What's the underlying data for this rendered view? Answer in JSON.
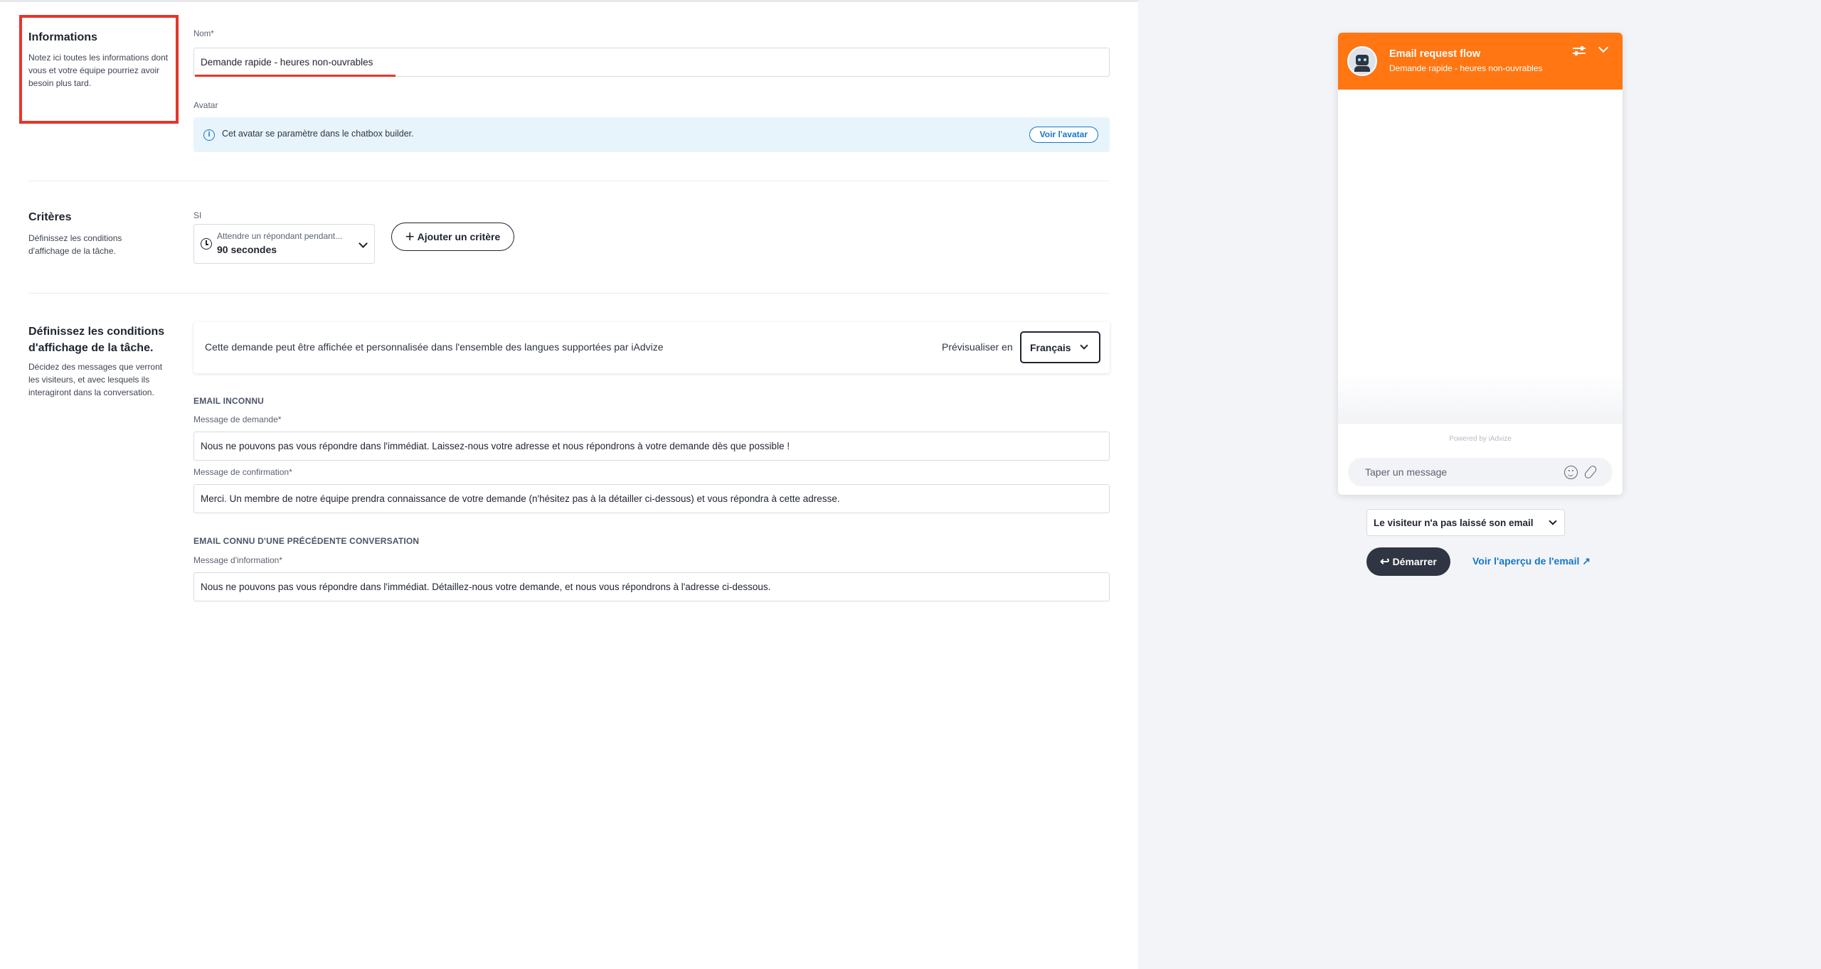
{
  "informations": {
    "title": "Informations",
    "description": "Notez ici toutes les informations dont vous et votre équipe pourriez avoir besoin plus tard.",
    "name_label": "Nom*",
    "name_value": "Demande rapide - heures non-ouvrables",
    "avatar_label": "Avatar",
    "avatar_info": "Cet avatar se paramètre dans le chatbox builder.",
    "avatar_button": "Voir l'avatar"
  },
  "criteres": {
    "title": "Critères",
    "description": "Définissez les conditions d'affichage de la tâche.",
    "si_label": "SI",
    "select_small": "Attendre un répondant pendant...",
    "select_value": "90 secondes",
    "add_button": "Ajouter un critère"
  },
  "affichage": {
    "title": "Définissez les conditions d'affichage de la tâche.",
    "description": "Décidez des messages que verront les visiteurs, et avec lesquels ils interagiront dans la conversation.",
    "lang_text": "Cette demande peut être affichée et personnalisée dans l'ensemble des langues supportées par iAdvize",
    "preview_label": "Prévisualiser en",
    "language": "Français",
    "email_inconnu_heading": "EMAIL INCONNU",
    "demande_label": "Message de demande*",
    "demande_value": "Nous ne pouvons pas vous répondre dans l'immédiat. Laissez-nous votre adresse et nous répondrons à votre demande dès que possible !",
    "confirmation_label": "Message de confirmation*",
    "confirmation_value": "Merci. Un membre de notre équipe prendra connaissance de votre demande (n'hésitez pas à la détailler ci-dessous) et vous répondra à cette adresse.",
    "email_connu_heading": "EMAIL CONNU D'UNE PRÉCÉDENTE CONVERSATION",
    "information_label": "Message d'information*",
    "information_value": "Nous ne pouvons pas vous répondre dans l'immédiat. Détaillez-nous votre demande, et nous vous répondrons à l'adresse ci-dessous."
  },
  "preview": {
    "chat_title": "Email request flow",
    "chat_subtitle": "Demande rapide - heures non-ouvrables",
    "powered_by": "Powered by iAdvize",
    "input_placeholder": "Taper un message",
    "visitor_state": "Le visiteur n'a pas laissé son email",
    "start_button": "Démarrer",
    "email_preview_link": "Voir l'aperçu de l'email ↗"
  },
  "colors": {
    "accent_orange": "#ff7613",
    "highlight_red": "#e5352b",
    "link_blue": "#1677c7",
    "dark": "#2f3542"
  },
  "icons": [
    "info-icon",
    "clock-icon",
    "chevron-down-icon",
    "plus-icon",
    "bot-avatar",
    "settings-icon",
    "emoji-icon",
    "paperclip-icon",
    "back-arrow-icon",
    "external-link-icon"
  ]
}
